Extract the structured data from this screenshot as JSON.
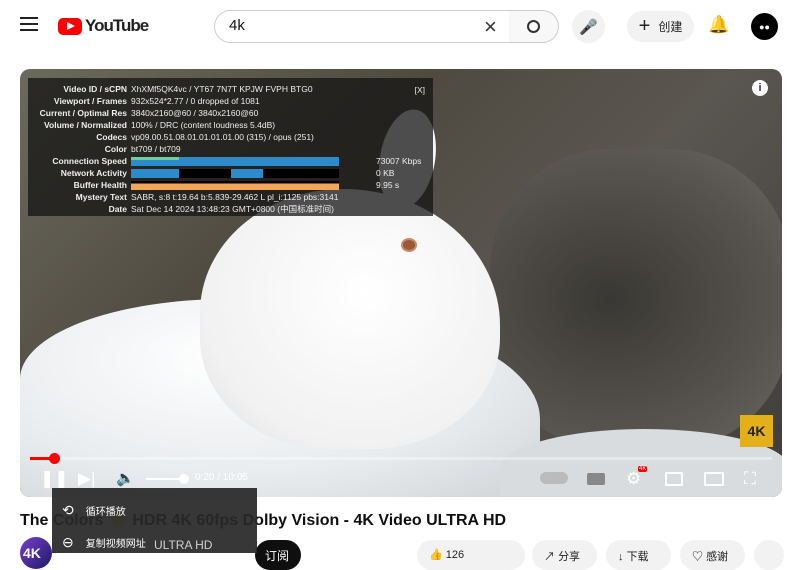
{
  "header": {
    "logo_text": "YouTube",
    "search_value": "4k",
    "create_label": "创建",
    "icons": [
      "menu-icon",
      "search-icon",
      "mic-icon",
      "bell-icon",
      "avatar"
    ]
  },
  "stats": {
    "close": "[X]",
    "rows": [
      {
        "k": "Video ID / sCPN",
        "v": "XhXMf5QK4vc  /  YT67  7N7T  KPJW  FVPH  BTG0"
      },
      {
        "k": "Viewport / Frames",
        "v": "932x524*2.77 / 0 dropped of 1081"
      },
      {
        "k": "Current / Optimal Res",
        "v": "3840x2160@60 / 3840x2160@60"
      },
      {
        "k": "Volume / Normalized",
        "v": "100% / DRC (content loudness 5.4dB)"
      },
      {
        "k": "Codecs",
        "v": "vp09.00.51.08.01.01.01.01.00 (315) / opus (251)"
      },
      {
        "k": "Color",
        "v": "bt709 / bt709"
      }
    ],
    "connection_speed": {
      "k": "Connection Speed",
      "v": "73007 Kbps"
    },
    "network_activity": {
      "k": "Network Activity",
      "v": "0 KB"
    },
    "buffer_health": {
      "k": "Buffer Health",
      "v": "9.95 s"
    },
    "mystery": {
      "k": "Mystery Text",
      "v": "SABR, s:8 t:19.64 b:5.839-29.462 L pl_i:1125 pbs:3141"
    },
    "date": {
      "k": "Date",
      "v": "Sat Dec 14 2024 13:48:23 GMT+0800 (中国标准时间)"
    },
    "colors": {
      "connection": "#2e8bc9",
      "buffer": "#f2a65a"
    }
  },
  "player": {
    "badge": "4K",
    "time": "0:20 / 10:05",
    "progress_fraction": 0.033,
    "volume_fraction": 1.0,
    "settings_badge": "4K"
  },
  "video": {
    "title": "The Colors 🌟 HDR 4K 60fps Dolby Vision - 4K Video ULTRA HD",
    "channel_avatar": "4K",
    "channel_name": "ULTRA HD",
    "subscribe": "订阅",
    "likes": "126",
    "share": "分享",
    "download": "下载",
    "thanks": "感谢"
  },
  "context_menu": {
    "items": [
      {
        "label": "循环播放",
        "icon": "loop-icon"
      },
      {
        "label": "复制视频网址",
        "icon": "link-icon"
      }
    ]
  }
}
